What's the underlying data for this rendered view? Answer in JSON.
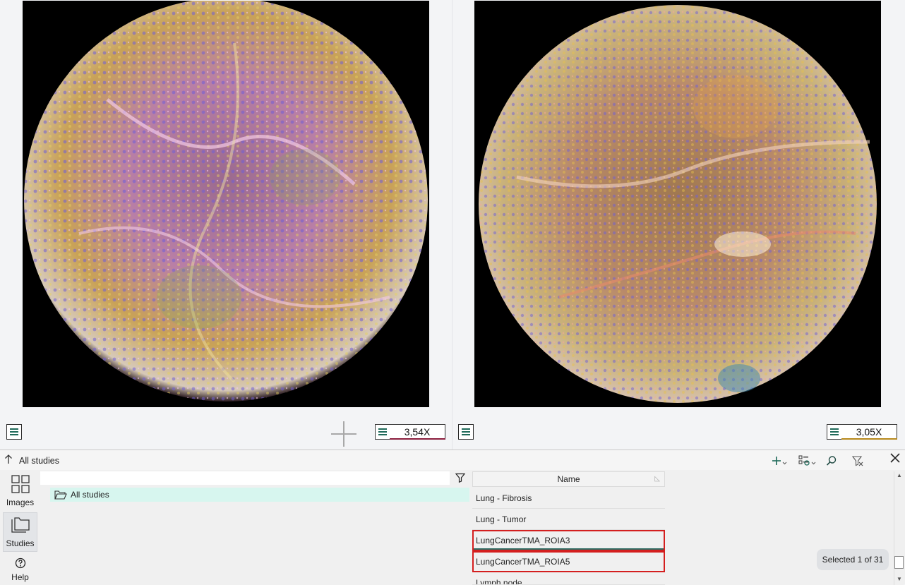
{
  "viewers": {
    "left": {
      "zoom": "3,54X",
      "image_name": "tissue-core-left"
    },
    "right": {
      "zoom": "3,05X",
      "image_name": "tissue-core-right"
    }
  },
  "panel": {
    "breadcrumb": "All studies",
    "tree": {
      "search_value": "",
      "root_label": "All studies"
    },
    "list": {
      "column_name": "Name",
      "rows": [
        {
          "label": "Lung - Fibrosis"
        },
        {
          "label": "Lung - Tumor"
        },
        {
          "label": "LungCancerTMA_ROIA3"
        },
        {
          "label": "LungCancerTMA_ROIA5"
        },
        {
          "label": "Lymph node"
        }
      ]
    },
    "selection_status": "Selected 1 of 31",
    "nav": {
      "images_label": "Images",
      "studies_label": "Studies",
      "help_label": "Help"
    }
  },
  "icons": {
    "menu": "hamburger-icon",
    "add": "plus-icon",
    "columns": "column-settings-icon",
    "search": "search-icon",
    "clear_filter": "clear-filter-icon",
    "close": "close-icon",
    "filter": "filter-icon",
    "folder": "folder-open-icon",
    "up": "arrow-up-icon",
    "images": "grid-icon",
    "studies": "folders-icon",
    "help": "help-icon"
  },
  "colors": {
    "tree_selection": "#d7f6ef",
    "highlight_outline": "#d41f1f",
    "zoom_left_accent": "#8a1c3c",
    "zoom_right_accent": "#b8891a",
    "icon_accent": "#1f6a5a"
  }
}
